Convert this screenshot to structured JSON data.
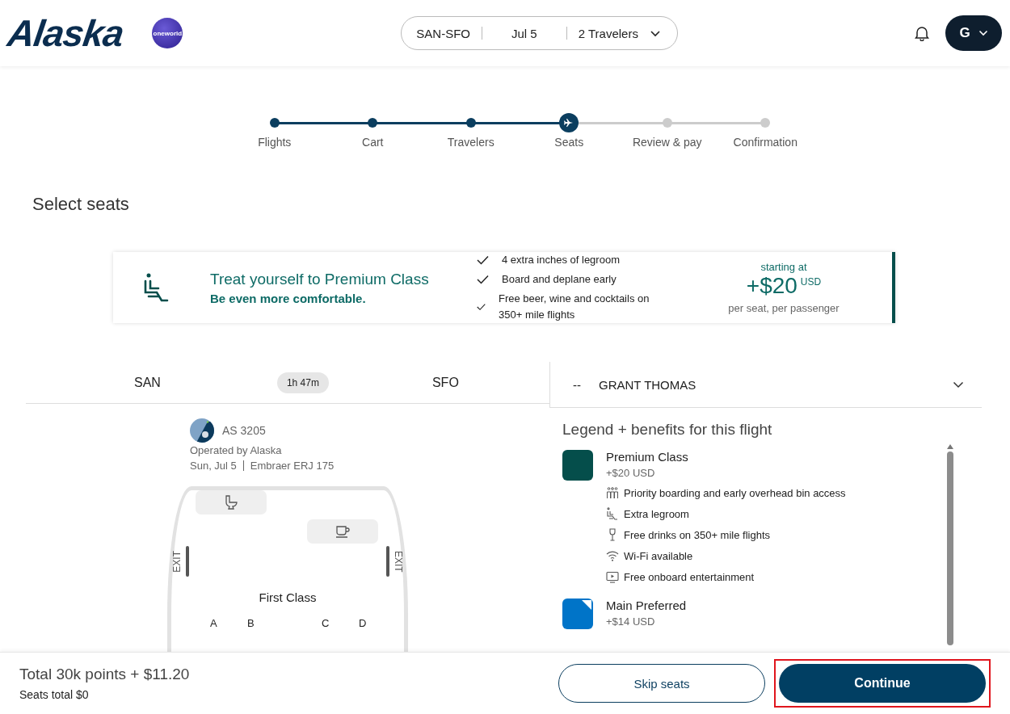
{
  "header": {
    "logo": "Alaska",
    "alliance": "oneworld",
    "trip": {
      "route": "SAN-SFO",
      "date": "Jul 5",
      "travelers": "2 Travelers"
    },
    "avatar": "G"
  },
  "steps": [
    {
      "label": "Flights",
      "completed": true,
      "selected": false
    },
    {
      "label": "Cart",
      "completed": true,
      "selected": false
    },
    {
      "label": "Travelers",
      "completed": true,
      "selected": false
    },
    {
      "label": "Seats",
      "completed": false,
      "selected": true
    },
    {
      "label": "Review & pay",
      "completed": false,
      "selected": false
    },
    {
      "label": "Confirmation",
      "completed": false,
      "selected": false
    }
  ],
  "page_title": "Select seats",
  "promo": {
    "title": "Treat yourself to Premium Class",
    "subtitle": "Be even more comfortable.",
    "benefits": [
      "4 extra inches of legroom",
      "Board and deplane early",
      "Free beer, wine and cocktails on 350+ mile flights"
    ],
    "price_caption": "starting at",
    "price": "+$20",
    "currency": "USD",
    "price_note": "per seat, per passenger"
  },
  "flight": {
    "origin": "SAN",
    "duration": "1h 47m",
    "destination": "SFO",
    "number": "AS 3205",
    "operator": "Operated by Alaska",
    "date": "Sun, Jul 5",
    "aircraft": "Embraer ERJ 175",
    "exit_labels": [
      "EXIT",
      "EXIT"
    ],
    "cabin": "First Class",
    "seat_columns": [
      "A",
      "B",
      "C",
      "D"
    ]
  },
  "passenger": {
    "seat": "--",
    "name": "GRANT THOMAS",
    "expanded": false
  },
  "legend": {
    "title": "Legend + benefits for this flight",
    "items": [
      {
        "name": "Premium Class",
        "price": "+$20 USD",
        "color": "#054e4b",
        "kind": "solid",
        "benefits": [
          {
            "kind": "boarding",
            "text": "Priority boarding and early overhead bin access"
          },
          {
            "kind": "legroom",
            "text": "Extra legroom"
          },
          {
            "kind": "drink",
            "text": "Free drinks on 350+ mile flights"
          },
          {
            "kind": "wifi",
            "text": "Wi-Fi available"
          },
          {
            "kind": "screen",
            "text": "Free onboard entertainment"
          }
        ]
      },
      {
        "name": "Main Preferred",
        "price": "+$14 USD",
        "color": "#0074c8",
        "kind": "corner"
      }
    ]
  },
  "footer": {
    "total": "Total 30k points + $11.20",
    "seats_total": "Seats total $0",
    "skip": "Skip seats",
    "continue": "Continue",
    "continue_highlighted": true
  }
}
